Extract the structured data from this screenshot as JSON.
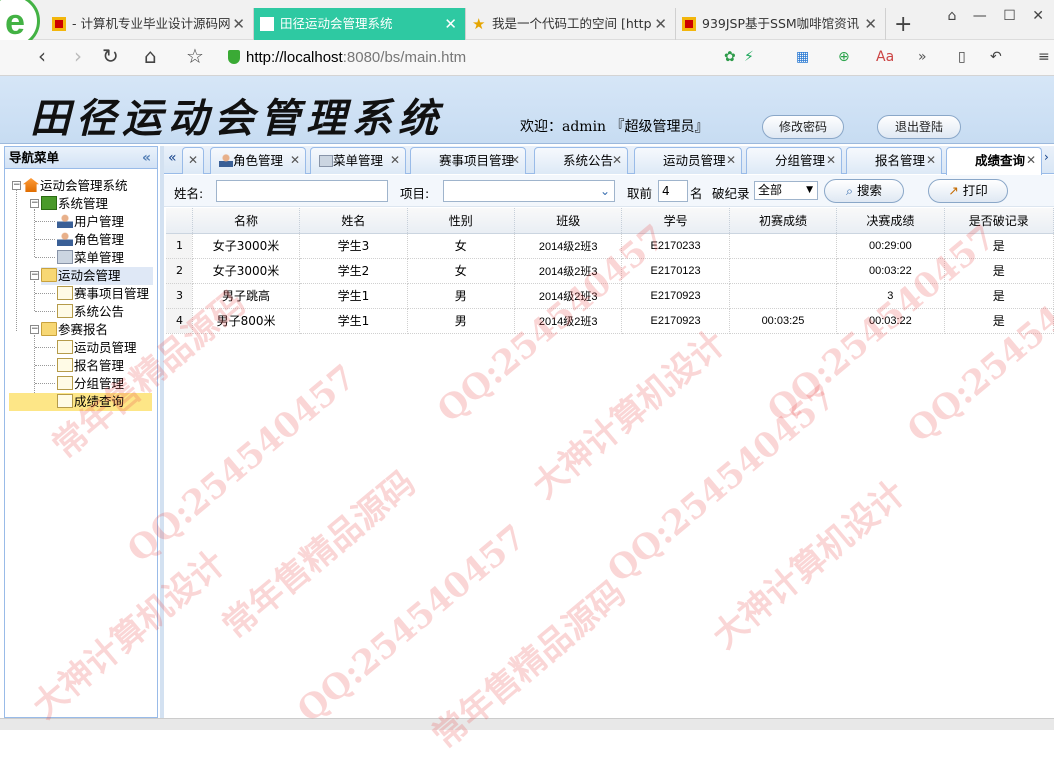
{
  "browser": {
    "tabs": [
      {
        "title": "- 计算机专业毕业设计源码网",
        "icon": "site-red-icon"
      },
      {
        "title": "田径运动会管理系统",
        "icon": "page-icon",
        "active": true
      },
      {
        "title": "我是一个代码工的空间 [http",
        "icon": "star-icon"
      },
      {
        "title": "939JSP基于SSM咖啡馆资讯",
        "icon": "site-red-icon"
      }
    ],
    "new_tab": "+",
    "url_host": "http://localhost",
    "url_rest": ":8080/bs/main.htm"
  },
  "header": {
    "title": "田径运动会管理系统",
    "welcome": "欢迎：admin 『超级管理员』",
    "change_password": "修改密码",
    "logout": "退出登陆"
  },
  "sidebar": {
    "title": "导航菜单",
    "collapse": "«",
    "root": "运动会管理系统",
    "groups": [
      {
        "label": "系统管理",
        "items": [
          "用户管理",
          "角色管理",
          "菜单管理"
        ]
      },
      {
        "label": "运动会管理",
        "items": [
          "赛事项目管理",
          "系统公告"
        ]
      },
      {
        "label": "参赛报名",
        "items": [
          "运动员管理",
          "报名管理",
          "分组管理",
          "成绩查询"
        ]
      }
    ],
    "selected": "成绩查询"
  },
  "content_tabs": [
    {
      "label": "角色管理"
    },
    {
      "label": "菜单管理"
    },
    {
      "label": "赛事项目管理"
    },
    {
      "label": "系统公告"
    },
    {
      "label": "运动员管理"
    },
    {
      "label": "分组管理"
    },
    {
      "label": "报名管理"
    },
    {
      "label": "成绩查询",
      "active": true
    }
  ],
  "toolbar": {
    "name_label": "姓名:",
    "name_value": "",
    "project_label": "项目:",
    "project_value": "",
    "top_label": "取前",
    "top_value": "4",
    "top_unit": "名",
    "record_label": "破纪录",
    "record_value": "全部",
    "search": "搜索",
    "print": "打印"
  },
  "grid": {
    "columns": [
      "",
      "名称",
      "姓名",
      "性别",
      "班级",
      "学号",
      "初赛成绩",
      "决赛成绩",
      "是否破记录"
    ],
    "rows": [
      [
        "1",
        "女子3000米",
        "学生3",
        "女",
        "2014级2班3",
        "E2170233",
        "",
        "00:29:00",
        "是"
      ],
      [
        "2",
        "女子3000米",
        "学生2",
        "女",
        "2014级2班3",
        "E2170123",
        "",
        "00:03:22",
        "是"
      ],
      [
        "3",
        "男子跳高",
        "学生1",
        "男",
        "2014级2班3",
        "E2170923",
        "",
        "3",
        "是"
      ],
      [
        "4",
        "男子800米",
        "学生1",
        "男",
        "2014级2班3",
        "E2170923",
        "00:03:25",
        "00:03:22",
        "是"
      ]
    ]
  },
  "watermarks": [
    "QQ:254540457",
    "常年售精品源码",
    "大神计算机设计"
  ]
}
